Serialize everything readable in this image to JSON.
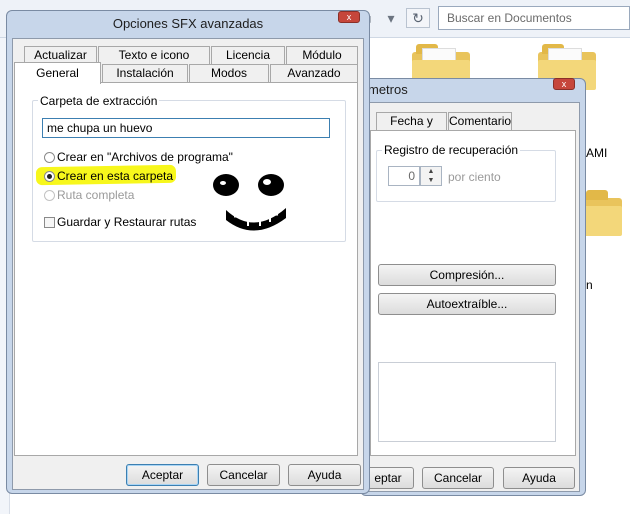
{
  "explorer": {
    "search_placeholder": "Buscar en Documentos",
    "refresh_glyph": "↻",
    "dropdown_glyph": "▾",
    "back_glyph": "◂",
    "fwd_glyph": "▸",
    "side_label_ami": "AMI",
    "side_label_n": "n"
  },
  "back_dialog": {
    "title_fragment": "metros",
    "tabs": [
      "Fecha y hora",
      "Comentario"
    ],
    "recovery_group_label": "Registro de recuperación",
    "recovery_value": "0",
    "recovery_unit": "por ciento",
    "compression_button": "Compresión...",
    "sfx_button": "Autoextraíble...",
    "footer_buttons": [
      "eptar",
      "Cancelar",
      "Ayuda"
    ]
  },
  "main_dialog": {
    "title": "Opciones SFX avanzadas",
    "close_glyph": "x",
    "tabs_row1": [
      "Actualizar",
      "Texto e icono",
      "Licencia",
      "Módulo"
    ],
    "tabs_row2": [
      "General",
      "Instalación",
      "Modos",
      "Avanzado"
    ],
    "extract_group_label": "Carpeta de extracción",
    "extract_path_value": "me chupa un huevo",
    "options": [
      {
        "label": "Crear en \"Archivos de programa\"",
        "state": "unchecked"
      },
      {
        "label": "Crear en esta carpeta",
        "state": "checked"
      },
      {
        "label": "Ruta completa",
        "state": "disabled"
      }
    ],
    "save_restore_label": "Guardar y Restaurar rutas",
    "buttons": {
      "accept": "Aceptar",
      "cancel": "Cancelar",
      "help": "Ayuda"
    }
  },
  "colors": {
    "highlight": "#f7f71c",
    "doodle": "#000000"
  }
}
